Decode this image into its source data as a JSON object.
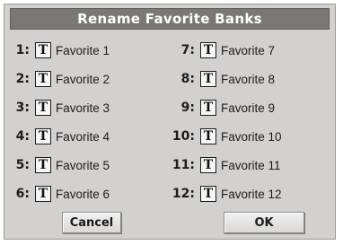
{
  "dialog": {
    "title": "Rename Favorite Banks"
  },
  "banks": [
    {
      "num": "1:",
      "name": "Favorite 1",
      "icon": "text-edit-icon"
    },
    {
      "num": "2:",
      "name": "Favorite 2",
      "icon": "text-edit-icon"
    },
    {
      "num": "3:",
      "name": "Favorite 3",
      "icon": "text-edit-icon"
    },
    {
      "num": "4:",
      "name": "Favorite 4",
      "icon": "text-edit-icon"
    },
    {
      "num": "5:",
      "name": "Favorite 5",
      "icon": "text-edit-icon"
    },
    {
      "num": "6:",
      "name": "Favorite 6",
      "icon": "text-edit-icon"
    },
    {
      "num": "7:",
      "name": "Favorite 7",
      "icon": "text-edit-icon"
    },
    {
      "num": "8:",
      "name": "Favorite 8",
      "icon": "text-edit-icon"
    },
    {
      "num": "9:",
      "name": "Favorite 9",
      "icon": "text-edit-icon"
    },
    {
      "num": "10:",
      "name": "Favorite 10",
      "icon": "text-edit-icon"
    },
    {
      "num": "11:",
      "name": "Favorite 11",
      "icon": "text-edit-icon"
    },
    {
      "num": "12:",
      "name": "Favorite 12",
      "icon": "text-edit-icon"
    }
  ],
  "text_icon_glyph": "T",
  "buttons": {
    "cancel": "Cancel",
    "ok": "OK"
  }
}
